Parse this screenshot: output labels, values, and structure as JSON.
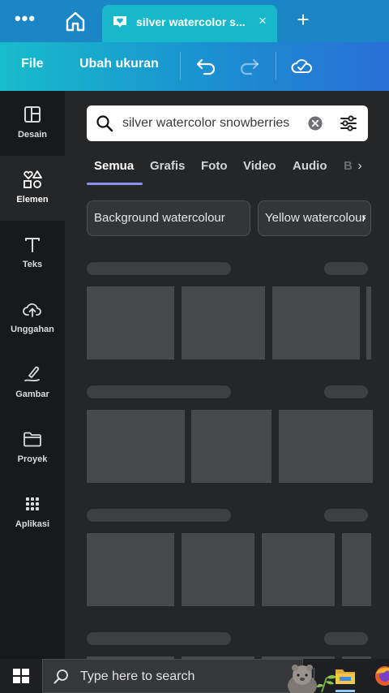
{
  "browser": {
    "menu_dots": "•••",
    "tab": {
      "title": "silver watercolor s...",
      "close": "×"
    },
    "new_tab": "+"
  },
  "toolbar": {
    "file_label": "File",
    "resize_label": "Ubah ukuran",
    "icons": [
      "undo-icon",
      "redo-icon",
      "cloud-saved-icon"
    ]
  },
  "sidebar": {
    "items": [
      {
        "label": "Desain",
        "icon": "layout-icon"
      },
      {
        "label": "Elemen",
        "icon": "elements-icon",
        "active": true
      },
      {
        "label": "Teks",
        "icon": "text-icon"
      },
      {
        "label": "Unggahan",
        "icon": "upload-cloud-icon"
      },
      {
        "label": "Gambar",
        "icon": "draw-icon"
      },
      {
        "label": "Proyek",
        "icon": "folder-icon"
      },
      {
        "label": "Aplikasi",
        "icon": "apps-grid-icon"
      }
    ]
  },
  "search": {
    "value": "silver watercolor snowberries",
    "placeholder": ""
  },
  "categories": {
    "tabs": [
      "Semua",
      "Grafis",
      "Foto",
      "Video",
      "Audio",
      "B"
    ],
    "active": "Semua",
    "next": "›"
  },
  "suggestions": {
    "chips": [
      "Background watercolour",
      "Yellow watercolour"
    ],
    "next": "›"
  },
  "taskbar": {
    "search_text": "Type here to search",
    "apps": [
      "file-explorer-icon",
      "firefox-icon"
    ]
  },
  "colors": {
    "tab_strip": "#1b86c6",
    "active_tab": "#17b8c9",
    "accent_underline": "#8b8ef0",
    "panel_bg": "#252627",
    "sidebar_bg": "#18191b"
  }
}
